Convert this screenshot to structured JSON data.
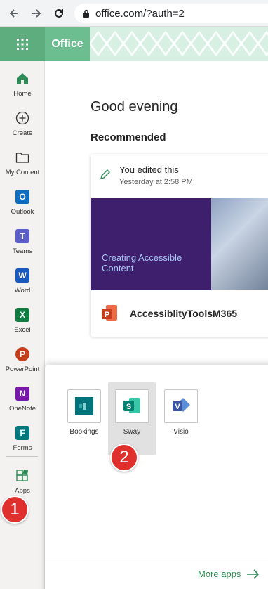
{
  "browser": {
    "url": "office.com/?auth=2"
  },
  "header": {
    "brand": "Office"
  },
  "rail": {
    "items": [
      {
        "label": "Home",
        "icon": "home-icon"
      },
      {
        "label": "Create",
        "icon": "plus-circle-icon"
      },
      {
        "label": "My Content",
        "icon": "folder-icon"
      },
      {
        "label": "Outlook",
        "icon": "outlook-icon",
        "letter": "O",
        "color": "#0f6cbd"
      },
      {
        "label": "Teams",
        "icon": "teams-icon",
        "letter": "T",
        "color": "#5b5fc7"
      },
      {
        "label": "Word",
        "icon": "word-icon",
        "letter": "W",
        "color": "#185abd"
      },
      {
        "label": "Excel",
        "icon": "excel-icon",
        "letter": "X",
        "color": "#107c41"
      },
      {
        "label": "PowerPoint",
        "icon": "powerpoint-icon",
        "letter": "P",
        "color": "#c43e1c"
      },
      {
        "label": "OneNote",
        "icon": "onenote-icon",
        "letter": "N",
        "color": "#7719aa"
      },
      {
        "label": "Forms",
        "icon": "forms-icon",
        "letter": "F",
        "color": "#03787c"
      },
      {
        "label": "Apps",
        "icon": "apps-icon"
      }
    ]
  },
  "main": {
    "greeting": "Good evening",
    "recommended": "Recommended",
    "card": {
      "activity": "You edited this",
      "time": "Yesterday at 2:58 PM",
      "thumbnail_text": "Creating Accessible Content",
      "file_name": "AccessiblityToolsM365"
    }
  },
  "flyout": {
    "apps": [
      {
        "label": "Bookings",
        "icon": "bookings-icon",
        "color": "#00747a"
      },
      {
        "label": "Sway",
        "icon": "sway-icon",
        "color": "#008272"
      },
      {
        "label": "Visio",
        "icon": "visio-icon",
        "color": "#3955a3"
      }
    ],
    "more_apps": "More apps"
  },
  "badges": {
    "step1": "1",
    "step2": "2"
  },
  "colors": {
    "brand_green": "#5ead7f",
    "badge_red": "#e0302d",
    "link_green": "#2b8a52"
  }
}
